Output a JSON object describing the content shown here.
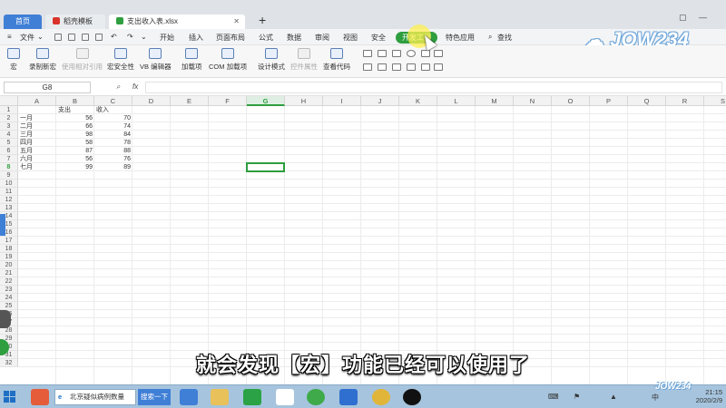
{
  "tabs": {
    "home": "首页",
    "template": "稻壳模板",
    "file": "支出收入表.xlsx"
  },
  "menu": {
    "file": "文件",
    "items": [
      "开始",
      "插入",
      "页面布局",
      "公式",
      "数据",
      "审阅",
      "视图",
      "安全",
      "开发工具",
      "特色应用"
    ],
    "search": "查找",
    "active_index": 8
  },
  "ribbon": {
    "buttons": [
      "宏",
      "录制新宏",
      "使用相对引用",
      "宏安全性",
      "VB 编辑器",
      "加载项",
      "COM 加载项",
      "设计模式",
      "控件属性",
      "查看代码"
    ],
    "dimmed": [
      2,
      8
    ]
  },
  "formula_bar": {
    "name_box": "G8",
    "fx": "fx"
  },
  "sheet": {
    "columns": [
      "A",
      "B",
      "C",
      "D",
      "E",
      "F",
      "G",
      "H",
      "I",
      "J",
      "K",
      "L",
      "M",
      "N",
      "O",
      "P",
      "Q",
      "R",
      "S"
    ],
    "selected_column": "G",
    "selected_row": 8,
    "rows": 32,
    "header_row": [
      "",
      "支出",
      "收入"
    ],
    "data": [
      [
        "一月",
        56,
        70
      ],
      [
        "二月",
        66,
        74
      ],
      [
        "三月",
        98,
        84
      ],
      [
        "四月",
        58,
        78
      ],
      [
        "五月",
        87,
        88
      ],
      [
        "六月",
        56,
        76
      ],
      [
        "七月",
        99,
        89
      ]
    ]
  },
  "subtitle": "就会发现【宏】功能已经可以使用了",
  "taskbar": {
    "ie_label": "北京疑似病例数量",
    "search_button": "搜索一下",
    "time": "21:15",
    "date": "2020/2/9",
    "ime": "中"
  },
  "colors": {
    "accent_green": "#2e9e3e",
    "tab_blue": "#3f7fd6",
    "taskbar": "#a6c4dd"
  }
}
